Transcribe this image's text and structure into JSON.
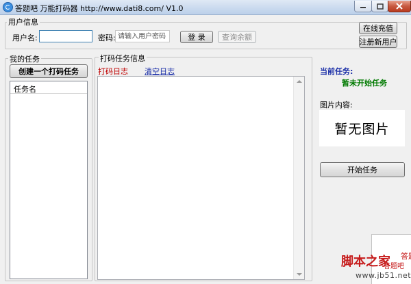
{
  "window": {
    "title": "答题吧 万能打码器 http://www.dati8.com/ V1.0",
    "accent_color": "#3c8fe0",
    "close_color": "#c75a41"
  },
  "user_info": {
    "legend": "用户信息",
    "username_label": "用户名:",
    "username_value": "",
    "password_label": "密码:",
    "password_placeholder": "请输入用户密码",
    "login_button": "登 录",
    "balance_button": "查询余额",
    "recharge_button": "在线充值",
    "register_button": "注册新用户"
  },
  "my_tasks": {
    "legend": "我的任务",
    "create_button": "创建一个打码任务",
    "column_header": "任务名"
  },
  "task_info": {
    "legend": "打码任务信息",
    "log_tab": "打码日志",
    "clear_link": "清空日志",
    "log_tab_color": "#c00000",
    "clear_link_color": "#1b2fa8"
  },
  "status": {
    "current_task_label": "当前任务:",
    "current_task_value": "暂未开始任务",
    "current_task_color": "#007a00",
    "image_label": "图片内容:",
    "image_placeholder": "暂无图片",
    "start_button": "开始任务"
  },
  "watermark": {
    "site_name": "脚本之家",
    "site_url": "www.jb51.net",
    "popup_text": "答题",
    "popup_sub": "答题吧"
  }
}
